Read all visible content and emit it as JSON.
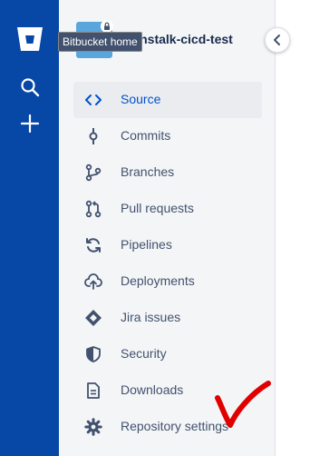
{
  "global_nav": {
    "home_tooltip": "Bitbucket home",
    "icons": [
      "bitbucket-logo-icon",
      "search-icon",
      "plus-icon"
    ],
    "bg_color": "#0747A6"
  },
  "repo": {
    "name": "beanstalk-cicd-test"
  },
  "sidebar": {
    "items": [
      {
        "label": "Source",
        "icon": "source-code-icon",
        "active": true
      },
      {
        "label": "Commits",
        "icon": "commit-icon"
      },
      {
        "label": "Branches",
        "icon": "branch-icon"
      },
      {
        "label": "Pull requests",
        "icon": "pull-request-icon"
      },
      {
        "label": "Pipelines",
        "icon": "pipelines-icon"
      },
      {
        "label": "Deployments",
        "icon": "deployments-icon"
      },
      {
        "label": "Jira issues",
        "icon": "jira-icon"
      },
      {
        "label": "Security",
        "icon": "shield-icon"
      },
      {
        "label": "Downloads",
        "icon": "document-icon"
      },
      {
        "label": "Repository settings",
        "icon": "gear-icon"
      }
    ],
    "active_color": "#0052CC"
  },
  "annotation": {
    "color": "#E00000",
    "icon": "red-checkmark"
  }
}
